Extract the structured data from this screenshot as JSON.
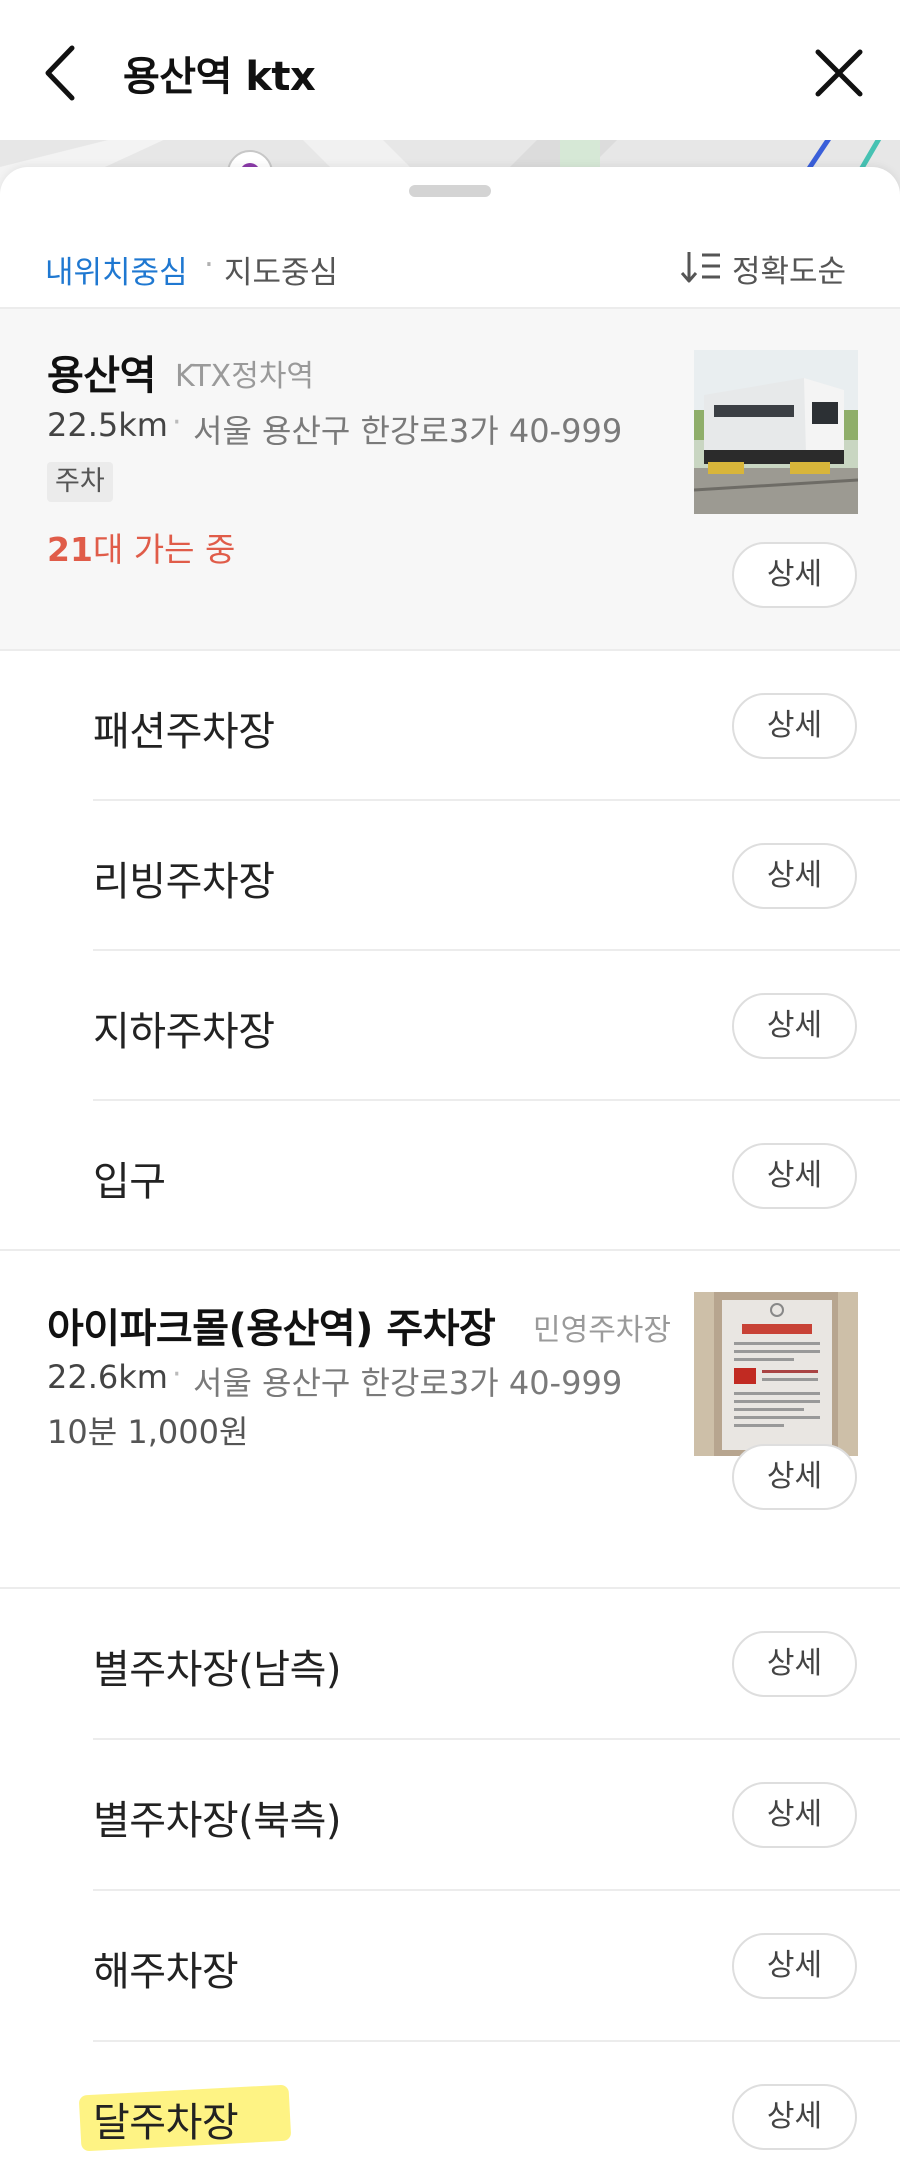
{
  "header": {
    "title": "용산역 ktx"
  },
  "filter": {
    "my_location": "내위치중심",
    "separator": "·",
    "map_center": "지도중심",
    "sort_label": "정확도순"
  },
  "places": [
    {
      "name": "용산역",
      "category": "KTX정차역",
      "distance": "22.5km",
      "dot": "·",
      "address": "서울 용산구 한강로3가 40-999",
      "tag": "주차",
      "going_count": "21",
      "going_suffix": "대 가는 중",
      "detail_label": "상세",
      "sub_items": [
        {
          "name": "패션주차장",
          "detail_label": "상세"
        },
        {
          "name": "리빙주차장",
          "detail_label": "상세"
        },
        {
          "name": "지하주차장",
          "detail_label": "상세"
        },
        {
          "name": "입구",
          "detail_label": "상세"
        }
      ]
    },
    {
      "name": "아이파크몰(용산역) 주차장",
      "category": "민영주차장",
      "distance": "22.6km",
      "dot": "·",
      "address": "서울 용산구 한강로3가 40-999",
      "price": "10분 1,000원",
      "detail_label": "상세",
      "sub_items": [
        {
          "name": "별주차장(남측)",
          "detail_label": "상세"
        },
        {
          "name": "별주차장(북측)",
          "detail_label": "상세"
        },
        {
          "name": "해주차장",
          "detail_label": "상세"
        },
        {
          "name": "달주차장",
          "detail_label": "상세"
        }
      ]
    }
  ],
  "colors": {
    "accent_blue": "#1f78d1",
    "going_red": "#e05c49",
    "highlighter_yellow": "#fef27a"
  }
}
